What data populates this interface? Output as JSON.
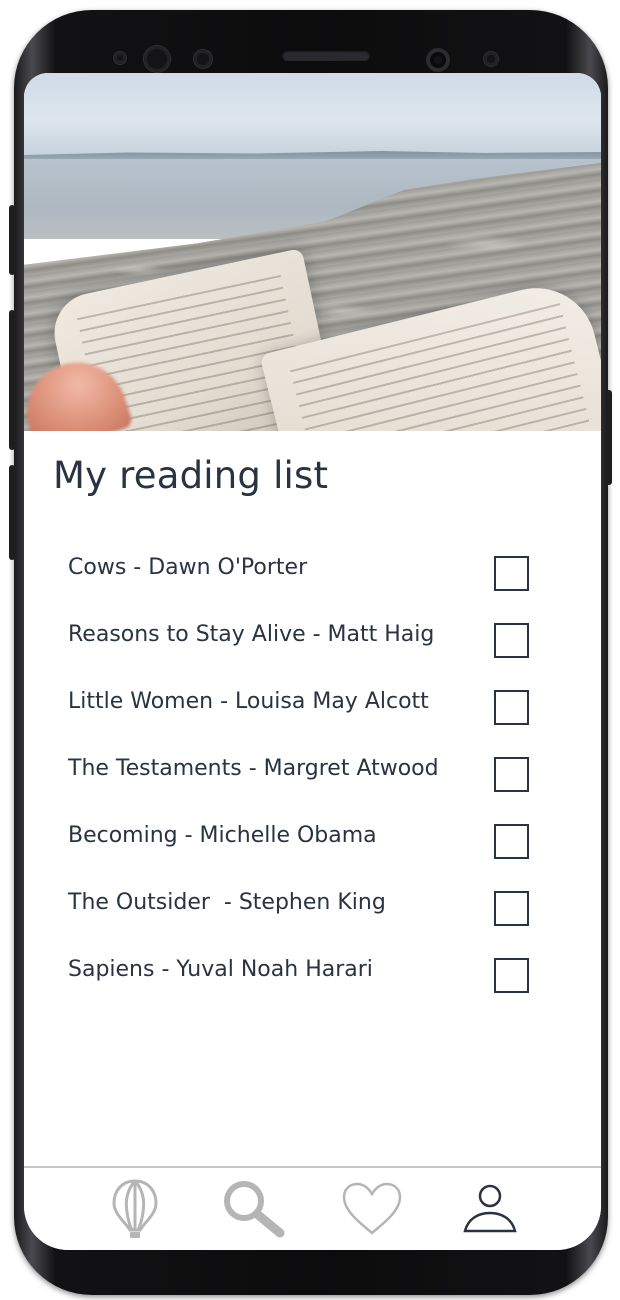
{
  "header": {
    "title": "My reading list"
  },
  "hero": {
    "image": "beach-reading-photo"
  },
  "books": [
    {
      "label": "Cows - Dawn O'Porter",
      "checked": false
    },
    {
      "label": "Reasons to Stay Alive - Matt Haig",
      "checked": false
    },
    {
      "label": "Little Women - Louisa May Alcott",
      "checked": false
    },
    {
      "label": "The Testaments - Margret Atwood",
      "checked": false
    },
    {
      "label": "Becoming - Michelle Obama",
      "checked": false
    },
    {
      "label": "The Outsider  - Stephen King",
      "checked": false
    },
    {
      "label": "Sapiens - Yuval Noah Harari",
      "checked": false
    }
  ],
  "tab_bar": {
    "tabs": [
      {
        "icon": "hot-air-balloon-icon",
        "active": false
      },
      {
        "icon": "search-icon",
        "active": false
      },
      {
        "icon": "heart-icon",
        "active": false
      },
      {
        "icon": "profile-icon",
        "active": true
      }
    ]
  },
  "colors": {
    "text": "#2a3342",
    "inactive_icon": "#b5b5b5",
    "active_icon": "#2a3342",
    "divider": "#c4c4c4"
  }
}
